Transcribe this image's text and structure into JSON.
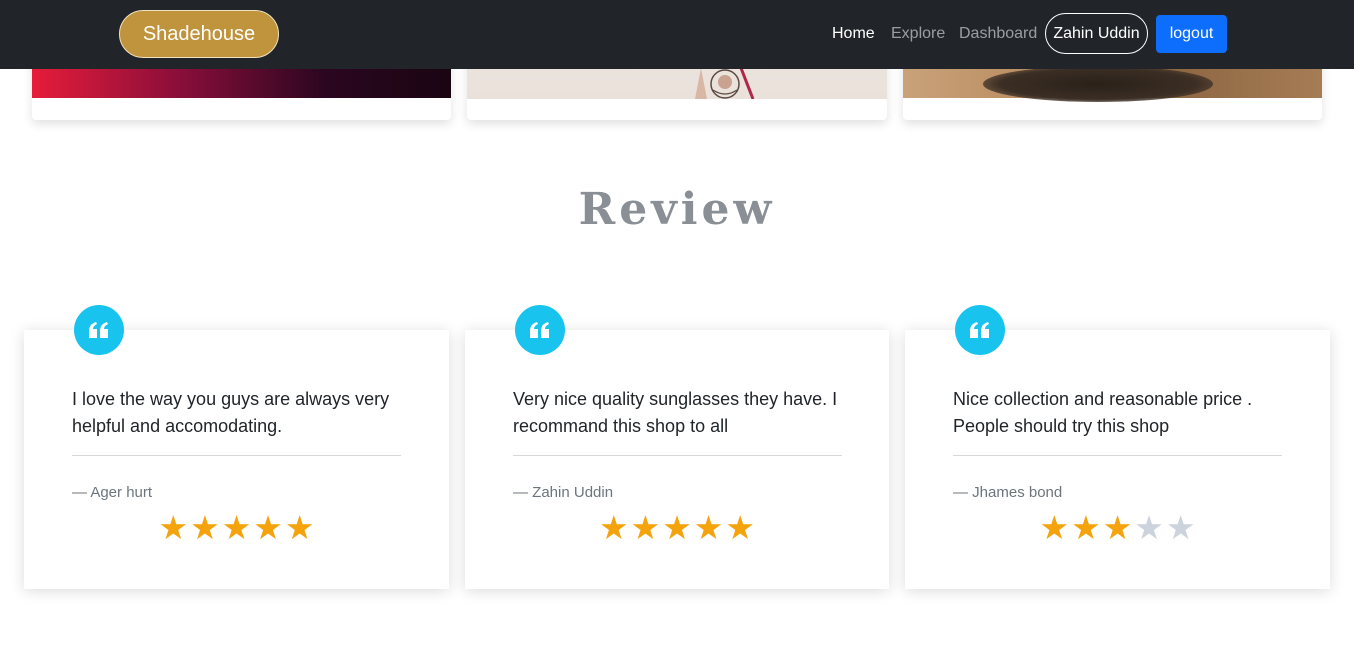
{
  "navbar": {
    "brand": "Shadehouse",
    "links": {
      "home": "Home",
      "explore": "Explore",
      "dashboard": "Dashboard"
    },
    "user_name": "Zahin Uddin",
    "logout_label": "logout"
  },
  "review_section": {
    "title": "Review",
    "reviews": [
      {
        "text": "I love the way you guys are always very helpful and accomodating.",
        "author": "— Ager hurt",
        "rating": 5,
        "max_rating": 5
      },
      {
        "text": "Very nice quality sunglasses they have. I recommand this shop to all",
        "author": "— Zahin Uddin",
        "rating": 5,
        "max_rating": 5
      },
      {
        "text": "Nice collection and reasonable price . People should try this shop",
        "author": "— Jhames bond",
        "rating": 3,
        "max_rating": 5
      }
    ]
  },
  "colors": {
    "navbar_bg": "#212529",
    "brand_bg": "#c0943d",
    "logout_bg": "#0d6efd",
    "quote_badge": "#18c3ee",
    "star_on": "#f4a30c",
    "star_off": "#ccd3dd"
  },
  "icons": {
    "quote": "quote-left-icon",
    "star": "star-icon"
  }
}
